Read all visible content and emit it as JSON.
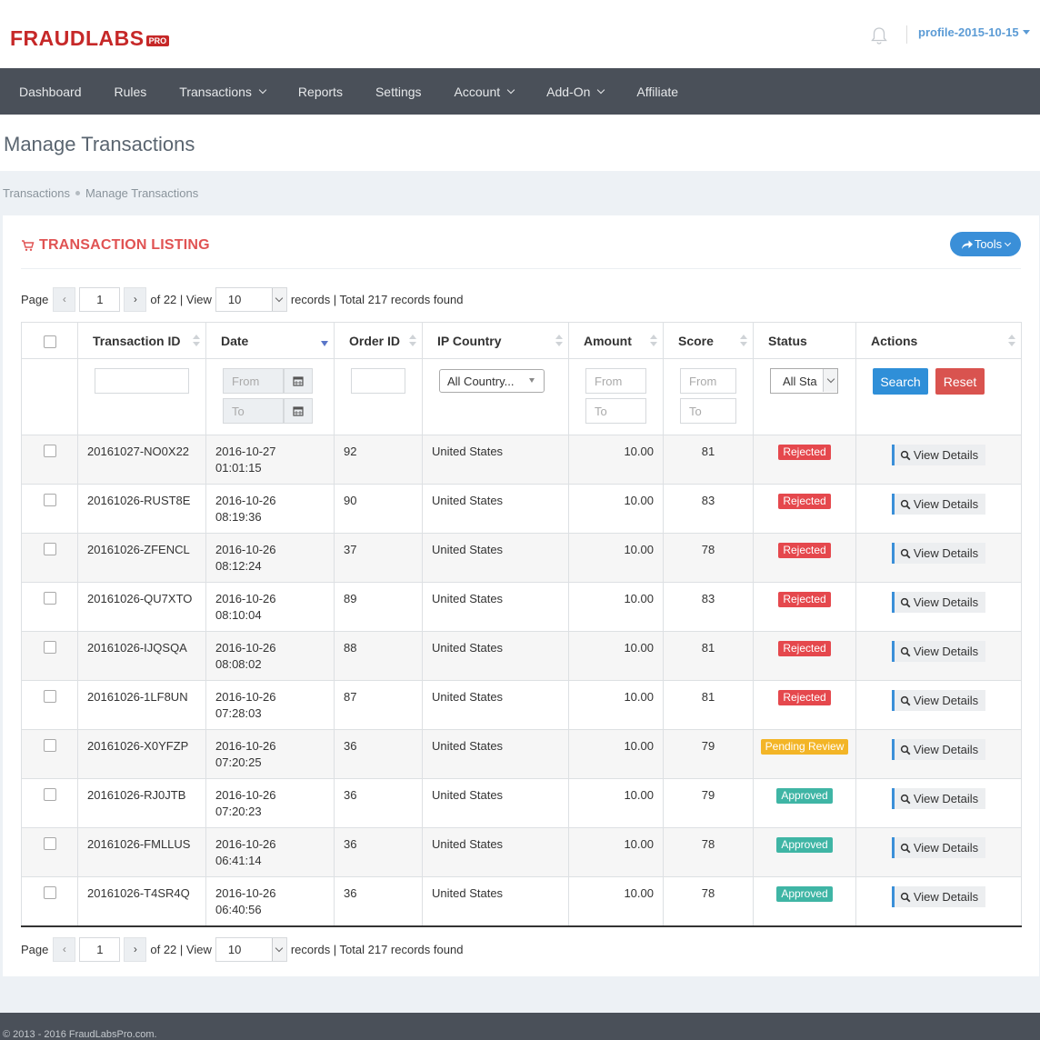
{
  "header": {
    "logo_text": "FRAUDLABS",
    "logo_badge": "PRO",
    "notification_icon": "bell-icon",
    "profile_name": "profile-2015-10-15"
  },
  "nav": {
    "items": [
      {
        "label": "Dashboard",
        "dropdown": false
      },
      {
        "label": "Rules",
        "dropdown": false
      },
      {
        "label": "Transactions",
        "dropdown": true
      },
      {
        "label": "Reports",
        "dropdown": false
      },
      {
        "label": "Settings",
        "dropdown": false
      },
      {
        "label": "Account",
        "dropdown": true
      },
      {
        "label": "Add-On",
        "dropdown": true
      },
      {
        "label": "Affiliate",
        "dropdown": false
      }
    ]
  },
  "page": {
    "title": "Manage Transactions",
    "breadcrumb": [
      "Transactions",
      "Manage Transactions"
    ]
  },
  "panel": {
    "title": "TRANSACTION LISTING",
    "title_icon": "cart-icon",
    "tools_label": "Tools"
  },
  "pager": {
    "page_label": "Page",
    "current_page": "1",
    "of_label": "of 22 | View",
    "view_count": "10",
    "summary": "records | Total 217 records found"
  },
  "table": {
    "columns": [
      "Transaction ID",
      "Date",
      "Order ID",
      "IP Country",
      "Amount",
      "Score",
      "Status",
      "Actions"
    ],
    "filters": {
      "date_from": "From",
      "date_to": "To",
      "country": "All Country...",
      "amount_from": "From",
      "amount_to": "To",
      "score_from": "From",
      "score_to": "To",
      "status": "All Sta",
      "search_label": "Search",
      "reset_label": "Reset"
    },
    "view_details_label": "View Details",
    "rows": [
      {
        "id": "20161027-NO0X22",
        "date": "2016-10-27",
        "time": "01:01:15",
        "order": "92",
        "country": "United States",
        "amount": "10.00",
        "score": "81",
        "status": "Rejected"
      },
      {
        "id": "20161026-RUST8E",
        "date": "2016-10-26",
        "time": "08:19:36",
        "order": "90",
        "country": "United States",
        "amount": "10.00",
        "score": "83",
        "status": "Rejected"
      },
      {
        "id": "20161026-ZFENCL",
        "date": "2016-10-26",
        "time": "08:12:24",
        "order": "37",
        "country": "United States",
        "amount": "10.00",
        "score": "78",
        "status": "Rejected"
      },
      {
        "id": "20161026-QU7XTO",
        "date": "2016-10-26",
        "time": "08:10:04",
        "order": "89",
        "country": "United States",
        "amount": "10.00",
        "score": "83",
        "status": "Rejected"
      },
      {
        "id": "20161026-IJQSQA",
        "date": "2016-10-26",
        "time": "08:08:02",
        "order": "88",
        "country": "United States",
        "amount": "10.00",
        "score": "81",
        "status": "Rejected"
      },
      {
        "id": "20161026-1LF8UN",
        "date": "2016-10-26",
        "time": "07:28:03",
        "order": "87",
        "country": "United States",
        "amount": "10.00",
        "score": "81",
        "status": "Rejected"
      },
      {
        "id": "20161026-X0YFZP",
        "date": "2016-10-26",
        "time": "07:20:25",
        "order": "36",
        "country": "United States",
        "amount": "10.00",
        "score": "79",
        "status": "Pending Review"
      },
      {
        "id": "20161026-RJ0JTB",
        "date": "2016-10-26",
        "time": "07:20:23",
        "order": "36",
        "country": "United States",
        "amount": "10.00",
        "score": "79",
        "status": "Approved"
      },
      {
        "id": "20161026-FMLLUS",
        "date": "2016-10-26",
        "time": "06:41:14",
        "order": "36",
        "country": "United States",
        "amount": "10.00",
        "score": "78",
        "status": "Approved"
      },
      {
        "id": "20161026-T4SR4Q",
        "date": "2016-10-26",
        "time": "06:40:56",
        "order": "36",
        "country": "United States",
        "amount": "10.00",
        "score": "78",
        "status": "Approved"
      }
    ]
  },
  "colors": {
    "brand": "#c62828",
    "nav_bg": "#4a5059",
    "accent_blue": "#3a8fd8",
    "rejected": "#e5484d",
    "pending": "#f3b527",
    "approved": "#3fb5a5"
  },
  "footer": {
    "text": "© 2013 - 2016 FraudLabsPro.com."
  }
}
